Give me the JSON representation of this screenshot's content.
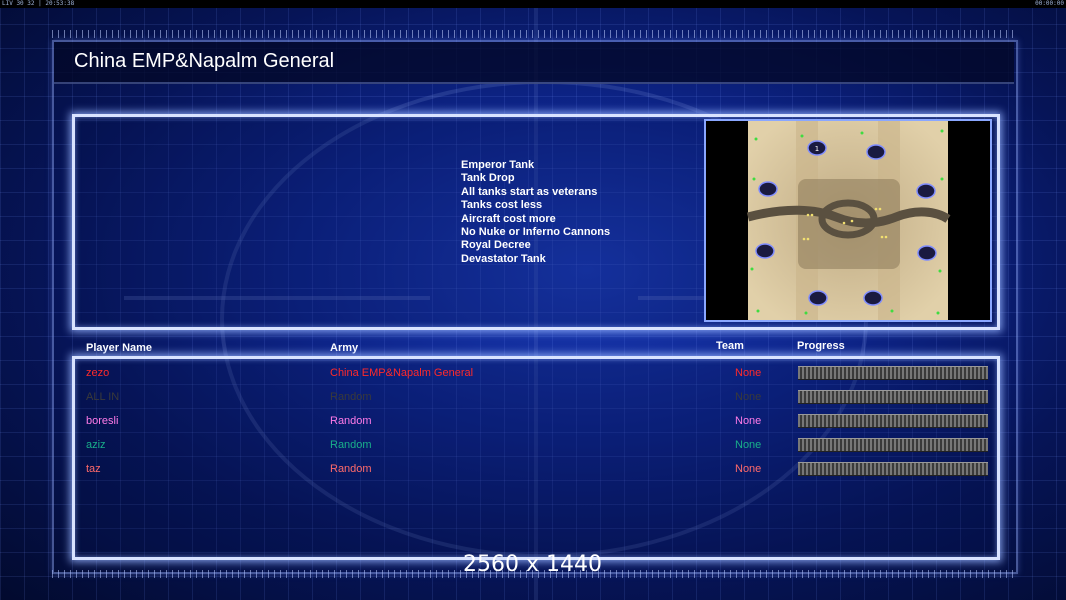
{
  "topbar": {
    "left_text": "LIV 30 32 | 20:53:38",
    "right_text": "00:00:00"
  },
  "title": "China EMP&Napalm General",
  "features": [
    "Emperor Tank",
    "Tank Drop",
    "All tanks start as veterans",
    "Tanks cost less",
    "Aircraft cost more",
    "No Nuke or Inferno Cannons",
    "Royal Decree",
    "Devastator Tank"
  ],
  "minimap": {
    "start_marker_label": "1"
  },
  "table": {
    "headers": {
      "player": "Player Name",
      "army": "Army",
      "team": "Team",
      "progress": "Progress"
    },
    "rows": [
      {
        "name": "zezo",
        "army": "China EMP&Napalm General",
        "team": "None",
        "color": "#ff2a2a"
      },
      {
        "name": "ALL IN",
        "army": "Random",
        "team": "None",
        "color": "#3a3a3a"
      },
      {
        "name": "boresli",
        "army": "Random",
        "team": "None",
        "color": "#ff7be8"
      },
      {
        "name": "aziz",
        "army": "Random",
        "team": "None",
        "color": "#19b08a"
      },
      {
        "name": "taz",
        "army": "Random",
        "team": "None",
        "color": "#ff6a6a"
      }
    ]
  },
  "resolution": "2560 x 1440"
}
